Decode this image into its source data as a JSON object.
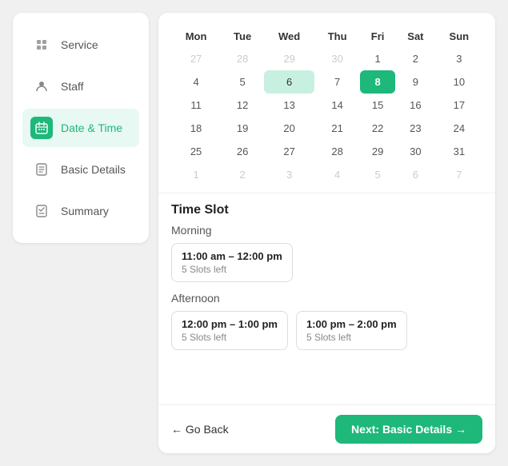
{
  "sidebar": {
    "items": [
      {
        "id": "service",
        "label": "Service",
        "icon": "▤",
        "active": false
      },
      {
        "id": "staff",
        "label": "Staff",
        "icon": "👤",
        "active": false
      },
      {
        "id": "datetime",
        "label": "Date & Time",
        "icon": "📅",
        "active": true
      },
      {
        "id": "basicdetails",
        "label": "Basic Details",
        "icon": "📄",
        "active": false
      },
      {
        "id": "summary",
        "label": "Summary",
        "icon": "✅",
        "active": false
      }
    ]
  },
  "calendar": {
    "headers": [
      "Mon",
      "Tue",
      "Wed",
      "Thu",
      "Fri",
      "Sat",
      "Sun"
    ],
    "rows": [
      [
        {
          "val": "27",
          "muted": true
        },
        {
          "val": "28",
          "muted": true
        },
        {
          "val": "29",
          "muted": true
        },
        {
          "val": "30",
          "muted": true
        },
        {
          "val": "1",
          "muted": false
        },
        {
          "val": "2",
          "muted": false
        },
        {
          "val": "3",
          "muted": false
        }
      ],
      [
        {
          "val": "4",
          "muted": false
        },
        {
          "val": "5",
          "muted": false
        },
        {
          "val": "6",
          "muted": false,
          "highlight": true
        },
        {
          "val": "7",
          "muted": false
        },
        {
          "val": "8",
          "muted": false,
          "selected": true
        },
        {
          "val": "9",
          "muted": false
        },
        {
          "val": "10",
          "muted": false
        }
      ],
      [
        {
          "val": "11",
          "muted": false
        },
        {
          "val": "12",
          "muted": false
        },
        {
          "val": "13",
          "muted": false
        },
        {
          "val": "14",
          "muted": false
        },
        {
          "val": "15",
          "muted": false
        },
        {
          "val": "16",
          "muted": false
        },
        {
          "val": "17",
          "muted": false
        }
      ],
      [
        {
          "val": "18",
          "muted": false
        },
        {
          "val": "19",
          "muted": false
        },
        {
          "val": "20",
          "muted": false
        },
        {
          "val": "21",
          "muted": false
        },
        {
          "val": "22",
          "muted": false
        },
        {
          "val": "23",
          "muted": false
        },
        {
          "val": "24",
          "muted": false
        }
      ],
      [
        {
          "val": "25",
          "muted": false
        },
        {
          "val": "26",
          "muted": false
        },
        {
          "val": "27",
          "muted": false
        },
        {
          "val": "28",
          "muted": false
        },
        {
          "val": "29",
          "muted": false
        },
        {
          "val": "30",
          "muted": false
        },
        {
          "val": "31",
          "muted": false
        }
      ],
      [
        {
          "val": "1",
          "muted": true
        },
        {
          "val": "2",
          "muted": true
        },
        {
          "val": "3",
          "muted": true
        },
        {
          "val": "4",
          "muted": true
        },
        {
          "val": "5",
          "muted": true
        },
        {
          "val": "6",
          "muted": true
        },
        {
          "val": "7",
          "muted": true
        }
      ]
    ]
  },
  "timeslot": {
    "title": "Time Slot",
    "groups": [
      {
        "label": "Morning",
        "slots": [
          {
            "time": "11:00 am – 12:00 pm",
            "slots_left": "5 Slots left"
          }
        ]
      },
      {
        "label": "Afternoon",
        "slots": [
          {
            "time": "12:00 pm – 1:00 pm",
            "slots_left": "5 Slots left"
          },
          {
            "time": "1:00 pm – 2:00 pm",
            "slots_left": "5 Slots left"
          }
        ]
      }
    ]
  },
  "footer": {
    "back_label": "← Go Back",
    "next_label": "Next: Basic Details →"
  },
  "colors": {
    "accent": "#1db87a",
    "highlight": "#c8f0e0"
  }
}
